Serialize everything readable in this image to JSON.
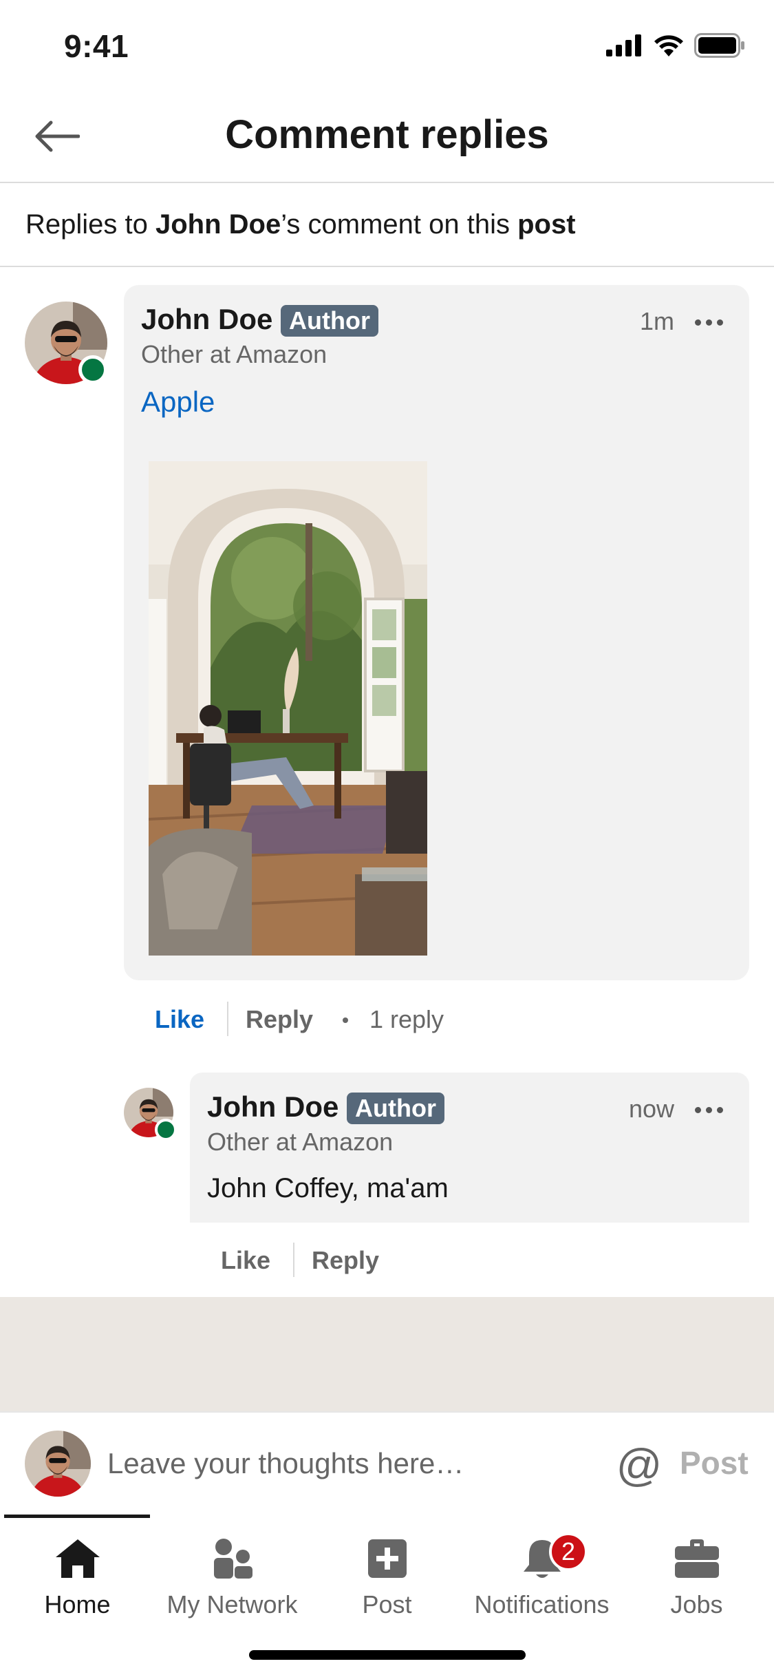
{
  "status_bar": {
    "time": "9:41"
  },
  "header": {
    "title": "Comment replies"
  },
  "context": {
    "prefix": "Replies to ",
    "name": "John Doe",
    "middle": "’s comment on this ",
    "target": "post"
  },
  "comment": {
    "author": "John Doe",
    "badge": "Author",
    "headline": "Other at Amazon",
    "time": "1m",
    "mention": "Apple",
    "actions": {
      "like": "Like",
      "reply": "Reply",
      "reply_count": "1 reply"
    }
  },
  "reply": {
    "author": "John Doe",
    "badge": "Author",
    "headline": "Other at Amazon",
    "time": "now",
    "text": "John Coffey, ma'am",
    "actions": {
      "like": "Like",
      "reply": "Reply"
    }
  },
  "composer": {
    "placeholder": "Leave your thoughts here…",
    "at_symbol": "@",
    "post_label": "Post"
  },
  "tabs": [
    {
      "label": "Home",
      "icon": "home-icon",
      "active": true
    },
    {
      "label": "My Network",
      "icon": "network-icon",
      "active": false
    },
    {
      "label": "Post",
      "icon": "plus-square-icon",
      "active": false
    },
    {
      "label": "Notifications",
      "icon": "bell-icon",
      "active": false,
      "badge": "2"
    },
    {
      "label": "Jobs",
      "icon": "briefcase-icon",
      "active": false
    }
  ],
  "colors": {
    "link": "#0a66c2",
    "badge": "#56687a",
    "presence": "#057642",
    "notification": "#cc1016"
  }
}
